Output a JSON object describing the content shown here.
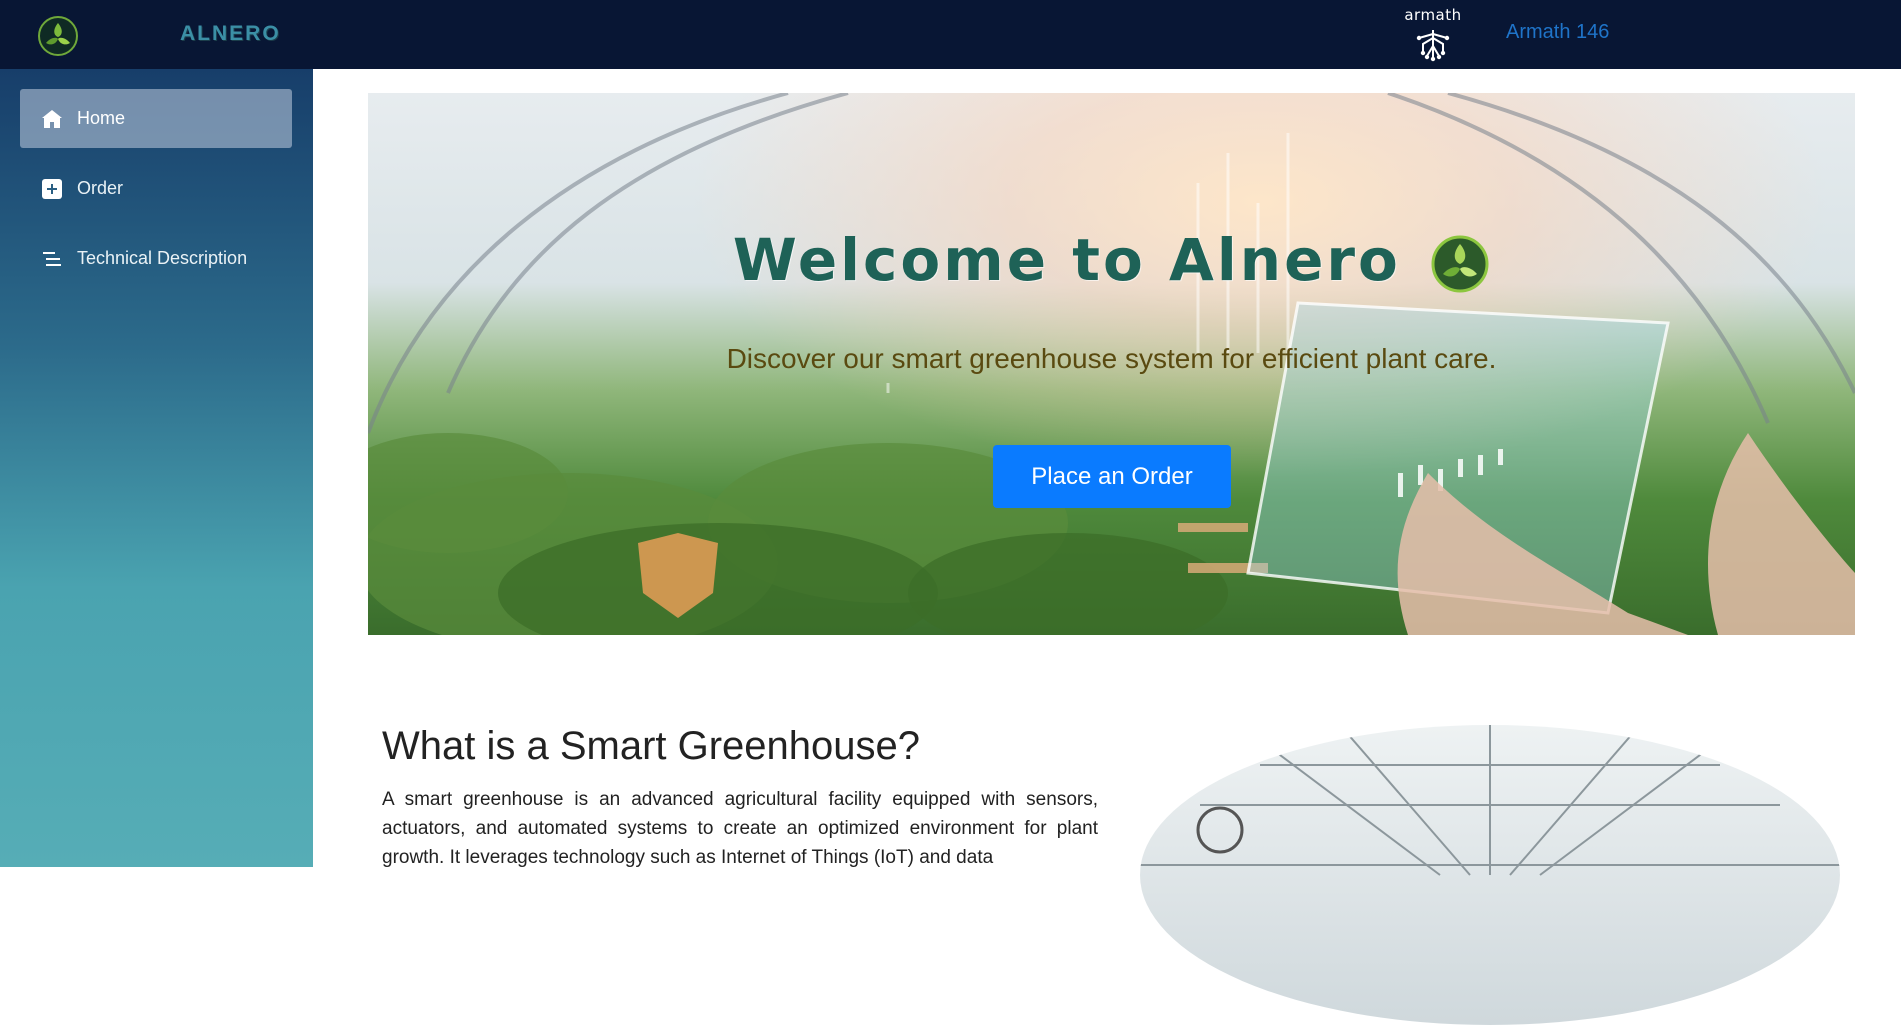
{
  "topbar": {
    "brand": "ALNERO",
    "partner_logo_text": "armath",
    "user": "Armath 146"
  },
  "sidebar": {
    "items": [
      {
        "label": "Home",
        "icon": "home-icon",
        "active": true
      },
      {
        "label": "Order",
        "icon": "plus-square-icon",
        "active": false
      },
      {
        "label": "Technical Description",
        "icon": "lines-icon",
        "active": false
      }
    ]
  },
  "hero": {
    "title": "Welcome to Alnero",
    "subtitle": "Discover our smart greenhouse system for efficient plant care.",
    "cta": "Place an Order"
  },
  "section": {
    "title": "What is a Smart Greenhouse?",
    "body": "A smart greenhouse is an advanced agricultural facility equipped with sensors, actuators, and automated systems to create an optimized environment for plant growth. It leverages technology such as Internet of Things (IoT) and data"
  },
  "colors": {
    "topbar_bg": "#081634",
    "brand": "#3b8fa6",
    "user_link": "#1f74c9",
    "cta": "#0a7bff",
    "title": "#1e6257"
  }
}
